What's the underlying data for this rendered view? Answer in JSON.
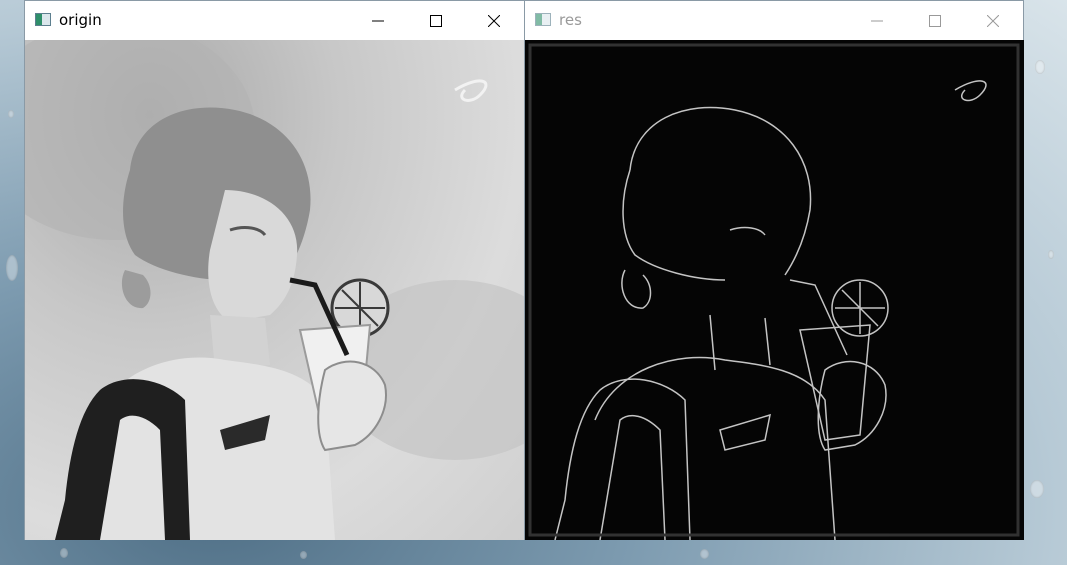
{
  "windows": [
    {
      "title": "origin",
      "active": true
    },
    {
      "title": "res",
      "active": false
    }
  ],
  "controls": {
    "minimize": "minimize",
    "maximize": "maximize",
    "close": "close"
  },
  "colors": {
    "titlebar": "#ffffff",
    "desktop": "#7d9bb0",
    "edge_line": "#e6e6e6",
    "dark": "#050505"
  },
  "icons": [
    "app-icon",
    "minimize-icon",
    "maximize-icon",
    "close-icon"
  ]
}
